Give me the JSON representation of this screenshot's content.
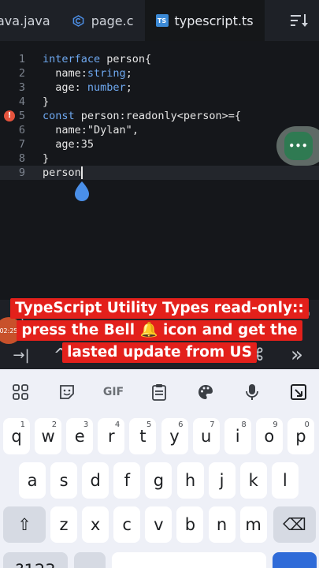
{
  "tabs": [
    {
      "label": "ava.java",
      "icon": "none"
    },
    {
      "label": "page.c",
      "icon": "c-language-icon"
    },
    {
      "label": "typescript.ts",
      "icon": "typescript-icon",
      "active": true
    }
  ],
  "editor": {
    "lines": [
      {
        "num": "1",
        "tokens": [
          {
            "t": "interface ",
            "c": "kw"
          },
          {
            "t": "person{",
            "c": "plain"
          }
        ]
      },
      {
        "num": "2",
        "tokens": [
          {
            "t": "  name:",
            "c": "plain"
          },
          {
            "t": "string",
            "c": "ty"
          },
          {
            "t": ";",
            "c": "plain"
          }
        ]
      },
      {
        "num": "3",
        "tokens": [
          {
            "t": "  age: ",
            "c": "plain"
          },
          {
            "t": "number",
            "c": "ty"
          },
          {
            "t": ";",
            "c": "plain"
          }
        ]
      },
      {
        "num": "4",
        "tokens": [
          {
            "t": "}",
            "c": "plain"
          }
        ]
      },
      {
        "num": "5",
        "tokens": [
          {
            "t": "const ",
            "c": "kw"
          },
          {
            "t": "person:readonly<person>={",
            "c": "plain"
          }
        ],
        "error": true
      },
      {
        "num": "6",
        "tokens": [
          {
            "t": "  name:",
            "c": "plain"
          },
          {
            "t": "\"Dylan\"",
            "c": "str"
          },
          {
            "t": ",",
            "c": "plain"
          }
        ]
      },
      {
        "num": "7",
        "tokens": [
          {
            "t": "  age:35",
            "c": "plain"
          }
        ]
      },
      {
        "num": "8",
        "tokens": [
          {
            "t": "}",
            "c": "plain"
          }
        ]
      },
      {
        "num": "9",
        "tokens": [
          {
            "t": "person",
            "c": "plain"
          }
        ],
        "current": true
      }
    ],
    "error_marker": "!",
    "fab_label": "•••"
  },
  "bottom": {
    "paren": "(",
    "quote": "''",
    "timer": "02:25"
  },
  "toolbar": {
    "tab_key": "→|",
    "caret": "^",
    "cmd": "⌘",
    "forward": "»"
  },
  "caption": {
    "line1": "TypeScript Utility Types read-only::",
    "line2": "press the Bell 🔔 icon and get the",
    "line3": "lasted update from US"
  },
  "keyboard": {
    "suggestions": [
      "apps-grid-icon",
      "sticker-icon",
      "GIF",
      "clipboard-icon",
      "palette-icon",
      "microphone-icon",
      "floating-keyboard-icon"
    ],
    "gif": "GIF",
    "row1": [
      {
        "k": "q",
        "h": "1"
      },
      {
        "k": "w",
        "h": "2"
      },
      {
        "k": "e",
        "h": "3"
      },
      {
        "k": "r",
        "h": "4"
      },
      {
        "k": "t",
        "h": "5"
      },
      {
        "k": "y",
        "h": "6"
      },
      {
        "k": "u",
        "h": "7"
      },
      {
        "k": "i",
        "h": "8"
      },
      {
        "k": "o",
        "h": "9"
      },
      {
        "k": "p",
        "h": "0"
      }
    ],
    "row2": [
      "a",
      "s",
      "d",
      "f",
      "g",
      "h",
      "j",
      "k",
      "l"
    ],
    "row3": [
      "z",
      "x",
      "c",
      "v",
      "b",
      "n",
      "m"
    ],
    "shift": "⇧",
    "backspace": "⌫",
    "bottom_left": "?123"
  }
}
